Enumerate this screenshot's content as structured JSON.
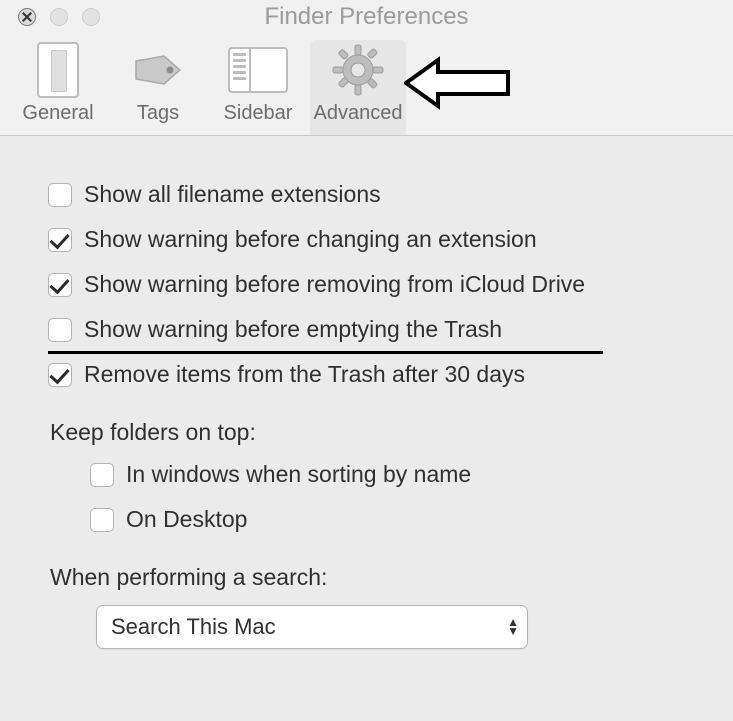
{
  "window": {
    "title": "Finder Preferences"
  },
  "tabs": {
    "general": "General",
    "tags": "Tags",
    "sidebar": "Sidebar",
    "advanced": "Advanced"
  },
  "options": {
    "show_all_extensions": {
      "label": "Show all filename extensions",
      "checked": false
    },
    "warn_change_extension": {
      "label": "Show warning before changing an extension",
      "checked": true
    },
    "warn_remove_icloud": {
      "label": "Show warning before removing from iCloud Drive",
      "checked": true
    },
    "warn_empty_trash": {
      "label": "Show warning before emptying the Trash",
      "checked": false
    },
    "remove_after_30_days": {
      "label": "Remove items from the Trash after 30 days",
      "checked": true
    }
  },
  "folders_section": {
    "heading": "Keep folders on top:",
    "in_windows": {
      "label": "In windows when sorting by name",
      "checked": false
    },
    "on_desktop": {
      "label": "On Desktop",
      "checked": false
    }
  },
  "search_section": {
    "heading": "When performing a search:",
    "selected": "Search This Mac"
  },
  "annotation": {
    "arrow_points_to": "advanced-tab"
  }
}
